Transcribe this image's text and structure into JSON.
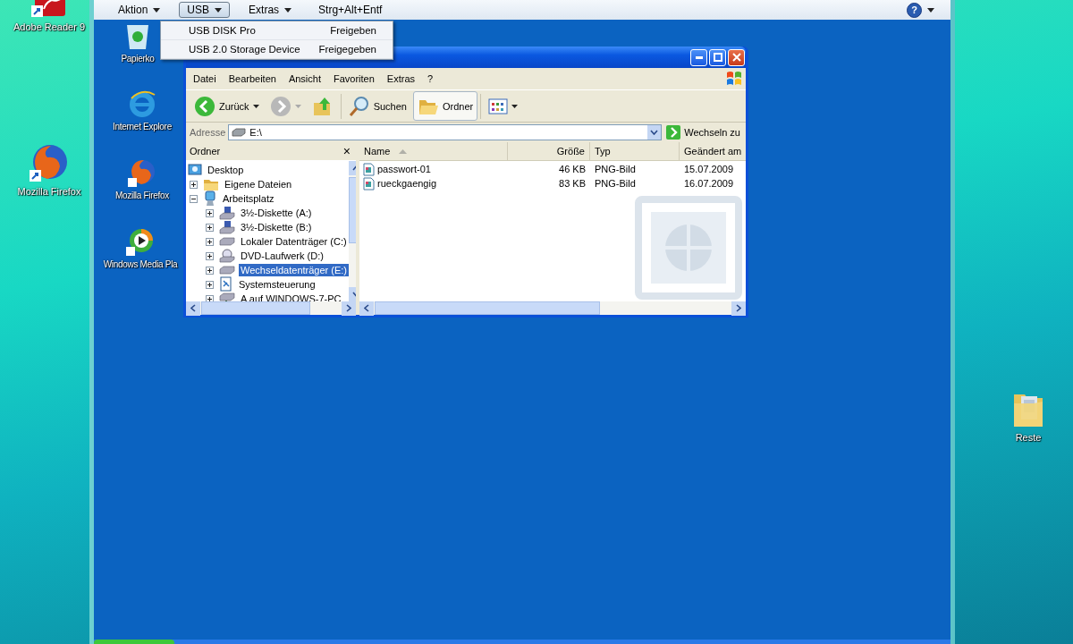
{
  "host_desktop": {
    "icons": [
      {
        "kind": "pdf",
        "label": "Adobe Reader 9"
      },
      {
        "kind": "firefox",
        "label": "Mozilla Firefox"
      },
      {
        "kind": "folder",
        "label": "Reste"
      }
    ]
  },
  "vm_toolbar": {
    "menus": [
      {
        "kind": "menu",
        "label": "Aktion",
        "selected": false
      },
      {
        "kind": "menu",
        "label": "USB",
        "selected": true
      },
      {
        "kind": "menu",
        "label": "Extras",
        "selected": false
      },
      {
        "kind": "button",
        "label": "Strg+Alt+Entf",
        "selected": false
      }
    ],
    "help": "?"
  },
  "usb_menu": [
    {
      "device": "USB DISK Pro",
      "status": "Freigeben"
    },
    {
      "device": "USB 2.0 Storage Device",
      "status": "Freigegeben"
    }
  ],
  "guest_desktop": {
    "icons": [
      {
        "kind": "recycle",
        "label": "Papierko"
      },
      {
        "kind": "ie",
        "label": "Internet Explore"
      },
      {
        "kind": "firefox",
        "label": "Mozilla Firefox"
      },
      {
        "kind": "media",
        "label": "Windows Media Pla"
      }
    ]
  },
  "explorer": {
    "menu": [
      "Datei",
      "Bearbeiten",
      "Ansicht",
      "Favoriten",
      "Extras",
      "?"
    ],
    "toolbar": [
      {
        "kind": "back",
        "label": "Zurück",
        "pressed": false
      },
      {
        "kind": "forward",
        "pressed": false
      },
      {
        "kind": "up",
        "pressed": false
      },
      {
        "kind": "search",
        "label": "Suchen",
        "pressed": false
      },
      {
        "kind": "folders",
        "label": "Ordner",
        "pressed": true
      },
      {
        "kind": "views",
        "pressed": false
      }
    ],
    "address_label": "Adresse",
    "address": "E:\\",
    "go": "Wechseln zu",
    "folders_title": "Ordner",
    "folders_close": "×",
    "tree": [
      {
        "kind": "desktop",
        "label": "Desktop",
        "selected": false,
        "children": [
          {
            "kind": "folder",
            "label": "Eigene Dateien",
            "expanded": false,
            "selected": false
          },
          {
            "kind": "computer",
            "label": "Arbeitsplatz",
            "expanded": true,
            "selected": false,
            "children": [
              {
                "kind": "floppy",
                "label": "3½-Diskette (A:)",
                "expanded": false,
                "selected": false
              },
              {
                "kind": "floppy",
                "label": "3½-Diskette (B:)",
                "expanded": false,
                "selected": false
              },
              {
                "kind": "disk",
                "label": "Lokaler Datenträger (C:)",
                "expanded": false,
                "selected": false
              },
              {
                "kind": "dvd",
                "label": "DVD-Laufwerk (D:)",
                "expanded": false,
                "selected": false
              },
              {
                "kind": "disk",
                "label": "Wechseldatenträger (E:)",
                "expanded": false,
                "selected": true
              },
              {
                "kind": "control",
                "label": "Systemsteuerung",
                "expanded": false,
                "selected": false
              },
              {
                "kind": "netdrive",
                "label": "A auf WINDOWS-7-PC",
                "expanded": false,
                "selected": false
              }
            ]
          }
        ]
      }
    ],
    "columns": [
      {
        "label": "Name",
        "sorted": true
      },
      {
        "label": "Größe",
        "sorted": false
      },
      {
        "label": "Typ",
        "sorted": false
      },
      {
        "label": "Geändert am",
        "sorted": false
      }
    ],
    "files": [
      {
        "name": "passwort-01",
        "size": "46 KB",
        "type": "PNG-Bild",
        "modified": "15.07.2009"
      },
      {
        "name": "rueckgaengig",
        "size": "83 KB",
        "type": "PNG-Bild",
        "modified": "16.07.2009"
      }
    ]
  }
}
